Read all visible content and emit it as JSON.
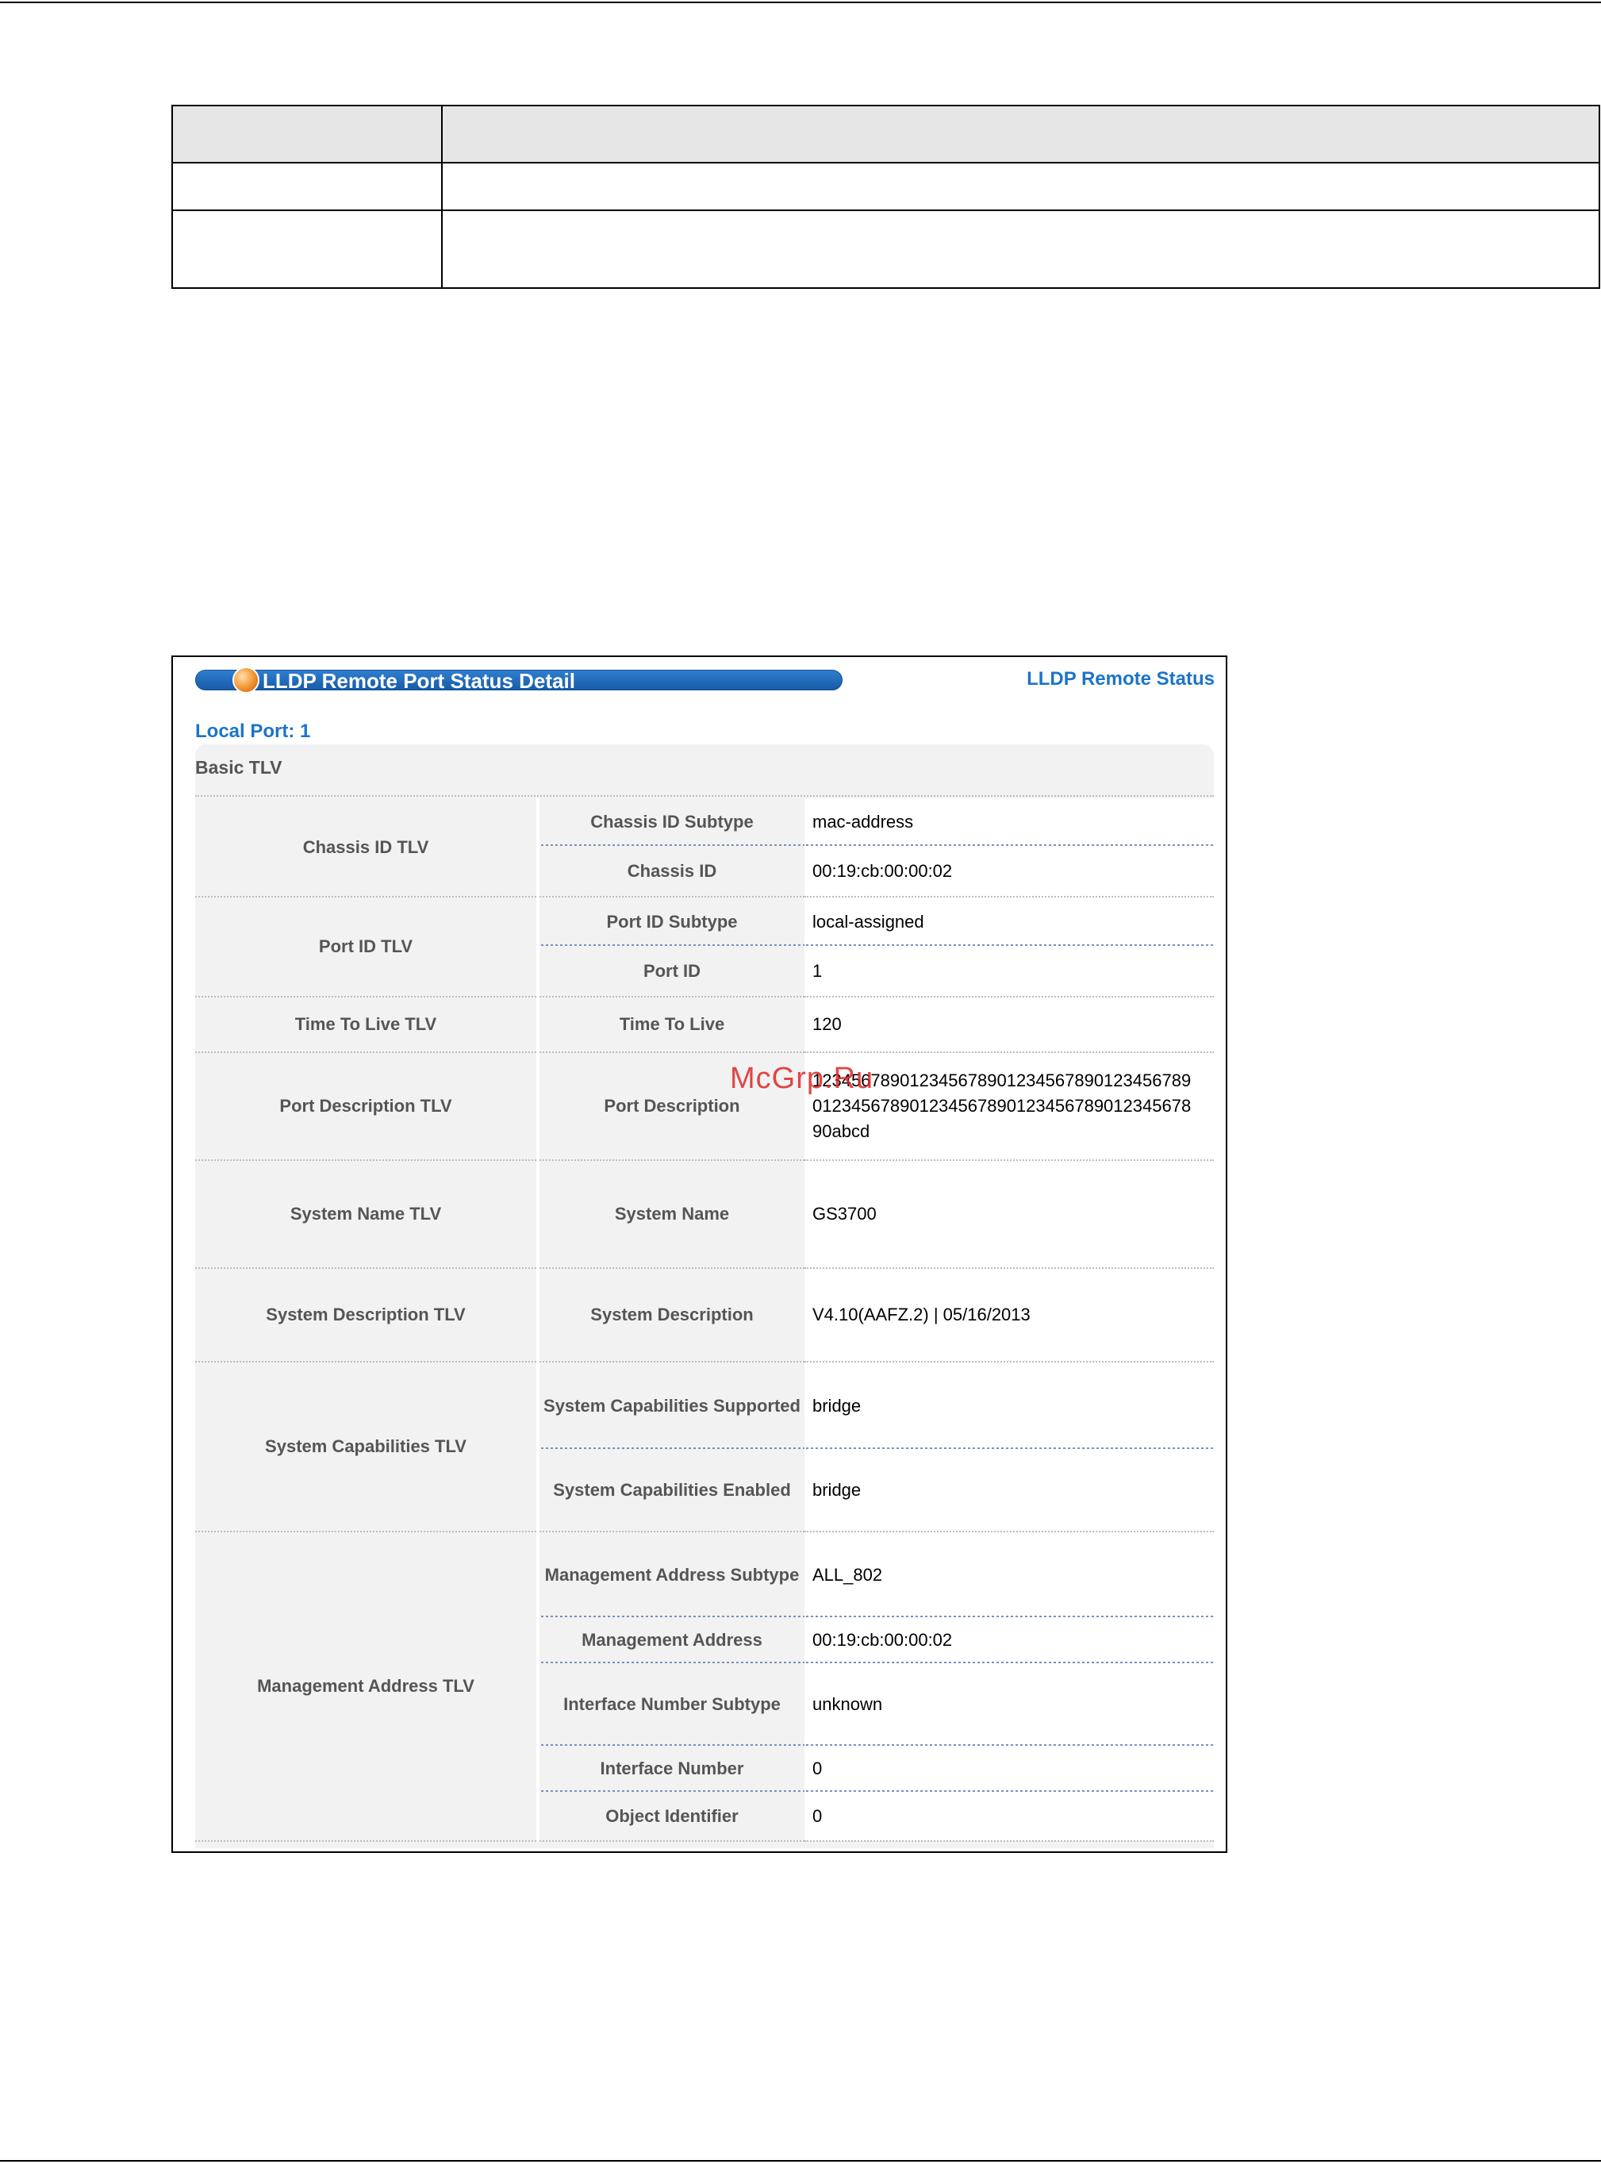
{
  "title": "LLDP Remote Port Status Detail",
  "status_link": "LLDP Remote Status",
  "local_port": "Local Port: 1",
  "section": "Basic TLV",
  "watermark": "McGrp.Ru",
  "tlvs": [
    {
      "name": "Chassis ID TLV",
      "fields": [
        {
          "label": "Chassis ID Subtype",
          "value": "mac-address"
        },
        {
          "label": "Chassis ID",
          "value": "00:19:cb:00:00:02"
        }
      ]
    },
    {
      "name": "Port ID TLV",
      "fields": [
        {
          "label": "Port ID Subtype",
          "value": "local-assigned"
        },
        {
          "label": "Port ID",
          "value": "1"
        }
      ]
    },
    {
      "name": "Time To Live TLV",
      "fields": [
        {
          "label": "Time To Live",
          "value": "120"
        }
      ]
    },
    {
      "name": "Port Description TLV",
      "fields": [
        {
          "label": "Port Description",
          "value": "12345678901234567890123456789012345678901234567890123456789012345678901234567890abcd"
        }
      ]
    },
    {
      "name": "System Name TLV",
      "fields": [
        {
          "label": "System Name",
          "value": "GS3700"
        }
      ]
    },
    {
      "name": "System Description TLV",
      "fields": [
        {
          "label": "System Description",
          "value": "V4.10(AAFZ.2) | 05/16/2013"
        }
      ]
    },
    {
      "name": "System Capabilities TLV",
      "fields": [
        {
          "label": "System Capabilities Supported",
          "value": "bridge"
        },
        {
          "label": "System Capabilities Enabled",
          "value": "bridge"
        }
      ]
    },
    {
      "name": "Management Address TLV",
      "fields": [
        {
          "label": "Management Address Subtype",
          "value": "ALL_802"
        },
        {
          "label": "Management Address",
          "value": "00:19:cb:00:00:02"
        },
        {
          "label": "Interface Number Subtype",
          "value": "unknown"
        },
        {
          "label": "Interface Number",
          "value": "0"
        },
        {
          "label": "Object Identifier",
          "value": "0"
        }
      ]
    }
  ]
}
